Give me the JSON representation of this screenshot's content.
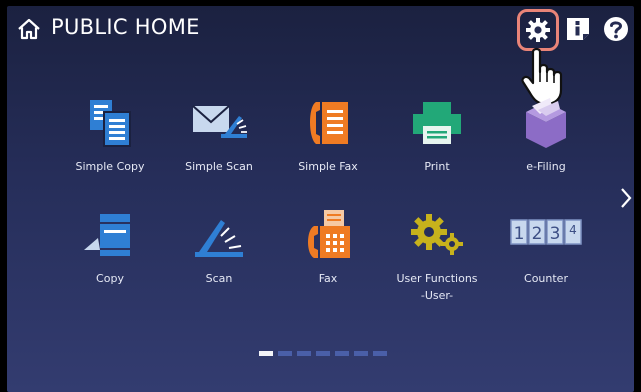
{
  "header": {
    "title": "PUBLIC HOME"
  },
  "apps_row1": [
    {
      "label": "Simple Copy"
    },
    {
      "label": "Simple Scan"
    },
    {
      "label": "Simple Fax"
    },
    {
      "label": "Print"
    },
    {
      "label": "e-Filing"
    }
  ],
  "apps_row2": [
    {
      "label": "Copy"
    },
    {
      "label": "Scan"
    },
    {
      "label": "Fax"
    },
    {
      "label": "User Functions",
      "label2": "-User-"
    },
    {
      "label": "Counter"
    }
  ],
  "counter_digits": [
    "1",
    "2",
    "3",
    "4"
  ],
  "pager": {
    "pages": 7,
    "current": 1
  },
  "colors": {
    "accent_blue": "#2f7fd4",
    "orange": "#ef7b23",
    "green": "#22a878",
    "purple": "#8c6cc6",
    "gold": "#c7b21c",
    "highlight_border": "#e98478"
  },
  "icons": {
    "home": "home-icon",
    "settings": "gear-icon",
    "info": "info-icon",
    "help": "help-icon",
    "pointer": "hand-pointer-icon",
    "next": "chevron-right-icon"
  }
}
